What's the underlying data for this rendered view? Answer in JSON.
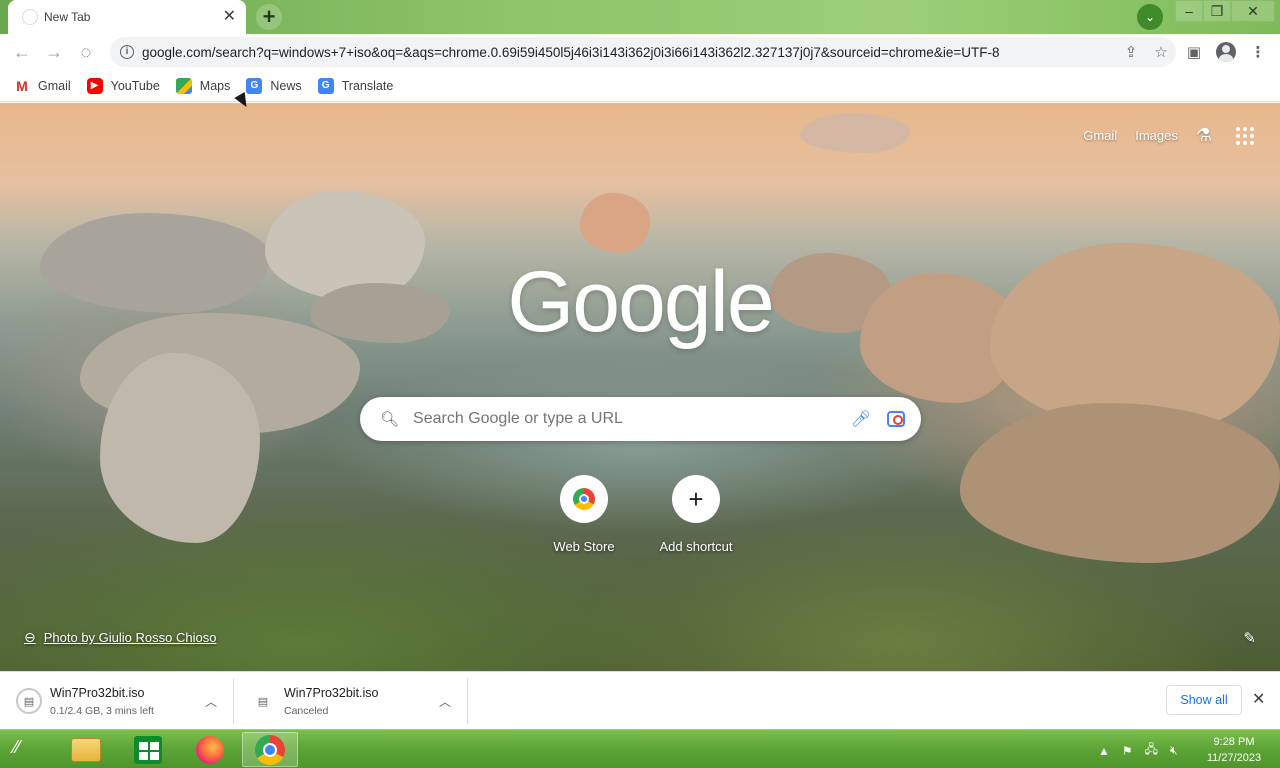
{
  "tab": {
    "title": "New Tab",
    "close": "✕"
  },
  "toolbar": {
    "url": "google.com/search?q=windows+7+iso&oq=&aqs=chrome.0.69i59i450l5j46i3i143i362j0i3i66i143i362l2.327137j0j7&sourceid=chrome&ie=UTF-8"
  },
  "bookmarks": [
    {
      "label": "Gmail",
      "icon": "gmail-icon"
    },
    {
      "label": "YouTube",
      "icon": "youtube-icon"
    },
    {
      "label": "Maps",
      "icon": "maps-icon"
    },
    {
      "label": "News",
      "icon": "news-icon"
    },
    {
      "label": "Translate",
      "icon": "translate-icon"
    }
  ],
  "ntp": {
    "top_links": {
      "gmail": "Gmail",
      "images": "Images"
    },
    "logo": "Google",
    "search_placeholder": "Search Google or type a URL",
    "shortcuts": [
      {
        "label": "Web Store"
      },
      {
        "label": "Add shortcut"
      }
    ],
    "attribution": "Photo by Giulio Rosso Chioso"
  },
  "downloads": {
    "items": [
      {
        "name": "Win7Pro32bit.iso",
        "status": "0.1/2.4 GB, 3 mins left"
      },
      {
        "name": "Win7Pro32bit.iso",
        "status": "Canceled"
      }
    ],
    "show_all": "Show all"
  },
  "taskbar": {
    "time": "9:28 PM",
    "date": "11/27/2023"
  },
  "colors": {
    "tabstrip": "#6aa84f",
    "accent_blue": "#1a73e8",
    "taskbar": "#5ea637"
  }
}
